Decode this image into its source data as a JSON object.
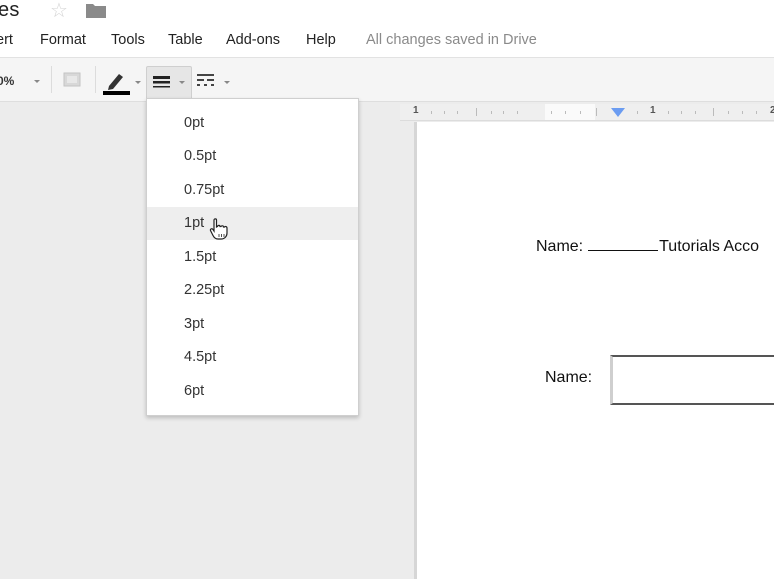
{
  "header": {
    "doc_title": "es",
    "star_icon": "☆",
    "folder_icon": "folder-icon"
  },
  "menu": {
    "items": [
      "ert",
      "Format",
      "Tools",
      "Table",
      "Add-ons",
      "Help"
    ],
    "save_status": "All changes saved in Drive"
  },
  "toolbar": {
    "zoom_value": "0%",
    "buttons": [
      "zoom-dropdown",
      "insert-comment",
      "border-color",
      "border-width",
      "border-dash"
    ]
  },
  "ruler": {
    "labels": [
      "1",
      "1",
      "2"
    ]
  },
  "border_width_menu": {
    "options": [
      "0pt",
      "0.5pt",
      "0.75pt",
      "1pt",
      "1.5pt",
      "2.25pt",
      "3pt",
      "4.5pt",
      "6pt"
    ],
    "hovered": "1pt"
  },
  "document": {
    "line1_prefix": "Name:",
    "line1_suffix": "Tutorials Acco",
    "line2_label": "Name:"
  }
}
